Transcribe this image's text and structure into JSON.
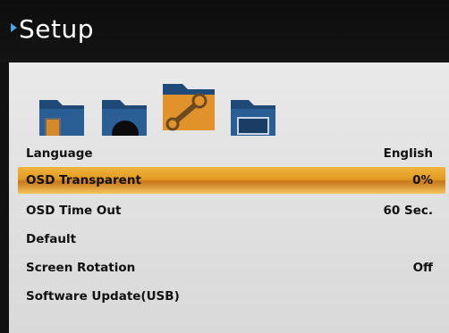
{
  "header": {
    "title": "Setup"
  },
  "tabs": [
    {
      "name": "picture-folder-icon"
    },
    {
      "name": "sound-folder-icon"
    },
    {
      "name": "setup-folder-icon",
      "selected": true
    },
    {
      "name": "screen-folder-icon"
    }
  ],
  "menu": [
    {
      "label": "Language",
      "value": "English"
    },
    {
      "label": "OSD Transparent",
      "value": "0%",
      "selected": true
    },
    {
      "label": "OSD Time Out",
      "value": "60 Sec."
    },
    {
      "label": "Default",
      "value": ""
    },
    {
      "label": "Screen Rotation",
      "value": "Off"
    },
    {
      "label": "Software Update(USB)",
      "value": ""
    }
  ],
  "colors": {
    "accent": "#4aa6e8",
    "highlight": "#e39a22",
    "panel": "#e6e6e6"
  }
}
